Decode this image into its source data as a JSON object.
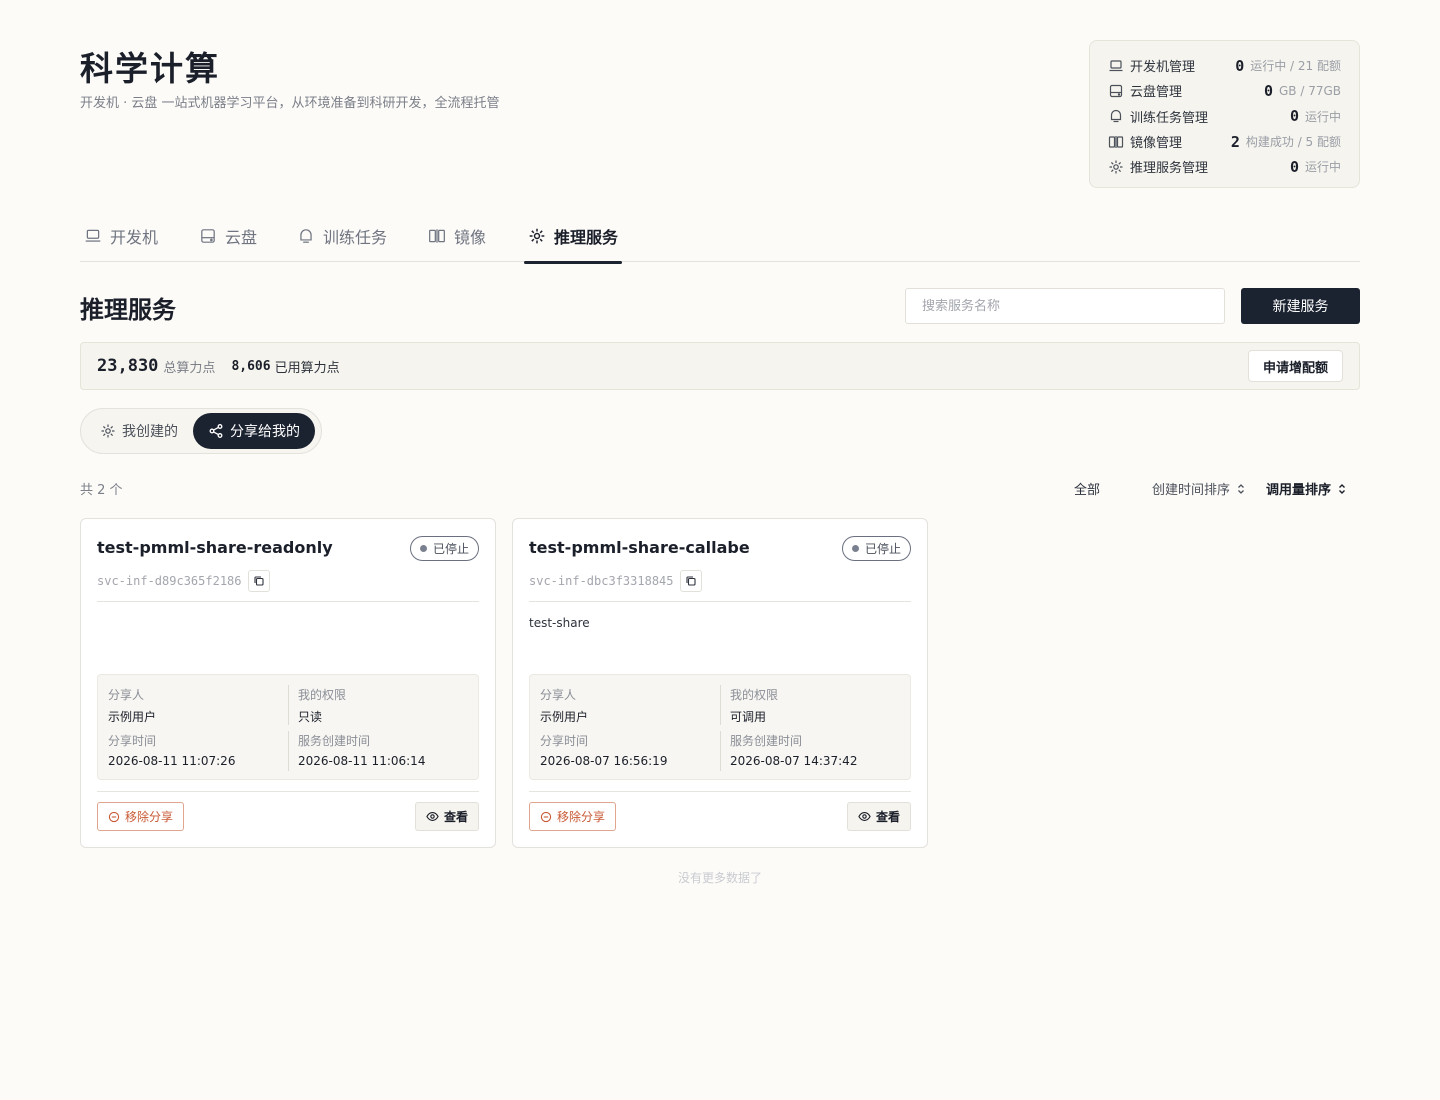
{
  "header": {
    "title": "科学计算",
    "subtitle": "开发机 · 云盘 一站式机器学习平台，从环境准备到科研开发，全流程托管"
  },
  "summary": [
    {
      "icon": "laptop-icon",
      "label": "开发机管理",
      "value": "0",
      "unit": "运行中 / 21 配额"
    },
    {
      "icon": "disk-icon",
      "label": "云盘管理",
      "value": "0",
      "unit": "GB / 77GB"
    },
    {
      "icon": "training-icon",
      "label": "训练任务管理",
      "value": "0",
      "unit": "运行中"
    },
    {
      "icon": "image-icon",
      "label": "镜像管理",
      "value": "2",
      "unit": "构建成功 / 5 配额"
    },
    {
      "icon": "inference-icon",
      "label": "推理服务管理",
      "value": "0",
      "unit": "运行中"
    }
  ],
  "tabs": [
    {
      "label": "开发机"
    },
    {
      "label": "云盘"
    },
    {
      "label": "训练任务"
    },
    {
      "label": "镜像"
    },
    {
      "label": "推理服务"
    }
  ],
  "section": {
    "title": "推理服务",
    "search_placeholder": "搜索服务名称",
    "new_button": "新建服务"
  },
  "quota": {
    "total_value": "23,830",
    "total_label": "总算力点",
    "used_value": "8,606",
    "used_label": "已用算力点",
    "apply_button": "申请增配额"
  },
  "segments": {
    "mine": "我创建的",
    "shared": "分享给我的"
  },
  "list": {
    "count": "共 2 个",
    "filter_all": "全部",
    "sort_created": "创建时间排序",
    "sort_calls": "调用量排序",
    "no_more": "没有更多数据了"
  },
  "cards": [
    {
      "name": "test-pmml-share-readonly",
      "status": "已停止",
      "id": "svc-inf-d89c365f2186",
      "description": "",
      "sharer_label": "分享人",
      "sharer": "示例用户",
      "permission_label": "我的权限",
      "permission": "只读",
      "share_time_label": "分享时间",
      "share_time": "2026-08-11 11:07:26",
      "created_label": "服务创建时间",
      "created": "2026-08-11 11:06:14",
      "remove_label": "移除分享",
      "view_label": "查看"
    },
    {
      "name": "test-pmml-share-callabe",
      "status": "已停止",
      "id": "svc-inf-dbc3f3318845",
      "description": "test-share",
      "sharer_label": "分享人",
      "sharer": "示例用户",
      "permission_label": "我的权限",
      "permission": "可调用",
      "share_time_label": "分享时间",
      "share_time": "2026-08-07 16:56:19",
      "created_label": "服务创建时间",
      "created": "2026-08-07 14:37:42",
      "remove_label": "移除分享",
      "view_label": "查看"
    }
  ],
  "colors": {
    "background": "#fcfbf8",
    "primary": "#1b2230",
    "danger": "#c85a35",
    "panel": "#f5f4ee"
  }
}
